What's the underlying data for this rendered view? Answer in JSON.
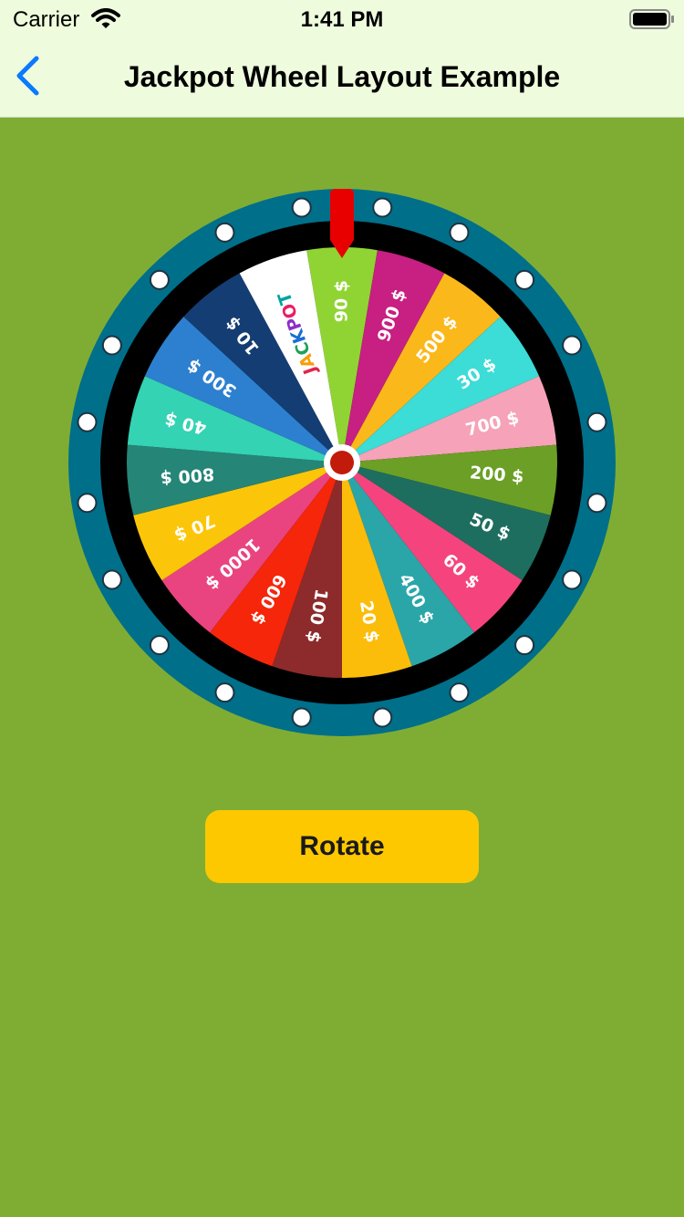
{
  "status_bar": {
    "carrier": "Carrier",
    "time": "1:41 PM",
    "wifi_icon": "wifi-icon",
    "battery_icon": "battery-full-icon"
  },
  "nav": {
    "back_icon": "chevron-left-icon",
    "title": "Jackpot Wheel Layout Example"
  },
  "wheel": {
    "pointer_color": "#e80000",
    "rim_color": "#006f8a",
    "slices": [
      {
        "label": "90 $",
        "color": "#90d433",
        "text_color": "#ffffff"
      },
      {
        "label": "900 $",
        "color": "#c71f82",
        "text_color": "#ffffff"
      },
      {
        "label": "500 $",
        "color": "#fbb81b",
        "text_color": "#ffffff"
      },
      {
        "label": "30 $",
        "color": "#3cdcd7",
        "text_color": "#ffffff"
      },
      {
        "label": "700 $",
        "color": "#f6a2b8",
        "text_color": "#ffffff"
      },
      {
        "label": "200 $",
        "color": "#6c9f26",
        "text_color": "#ffffff"
      },
      {
        "label": "50 $",
        "color": "#1d6e5e",
        "text_color": "#ffffff"
      },
      {
        "label": "60 $",
        "color": "#f5447d",
        "text_color": "#ffffff"
      },
      {
        "label": "400 $",
        "color": "#2aa6a9",
        "text_color": "#ffffff"
      },
      {
        "label": "20 $",
        "color": "#fbbd0a",
        "text_color": "#ffffff"
      },
      {
        "label": "100 $",
        "color": "#8d2a2b",
        "text_color": "#ffffff"
      },
      {
        "label": "600 $",
        "color": "#f52609",
        "text_color": "#ffffff"
      },
      {
        "label": "1000 $",
        "color": "#ea4480",
        "text_color": "#ffffff"
      },
      {
        "label": "70 $",
        "color": "#fbc609",
        "text_color": "#ffffff"
      },
      {
        "label": "800 $",
        "color": "#258577",
        "text_color": "#ffffff"
      },
      {
        "label": "40 $",
        "color": "#34d3b3",
        "text_color": "#ffffff"
      },
      {
        "label": "300 $",
        "color": "#2d80cf",
        "text_color": "#ffffff"
      },
      {
        "label": "10 $",
        "color": "#143d73",
        "text_color": "#ffffff"
      },
      {
        "label": "JACKPOT",
        "color": "#ffffff",
        "text_color": "#1a1a1a",
        "jackpot": true
      }
    ]
  },
  "rotate_button": {
    "label": "Rotate"
  }
}
